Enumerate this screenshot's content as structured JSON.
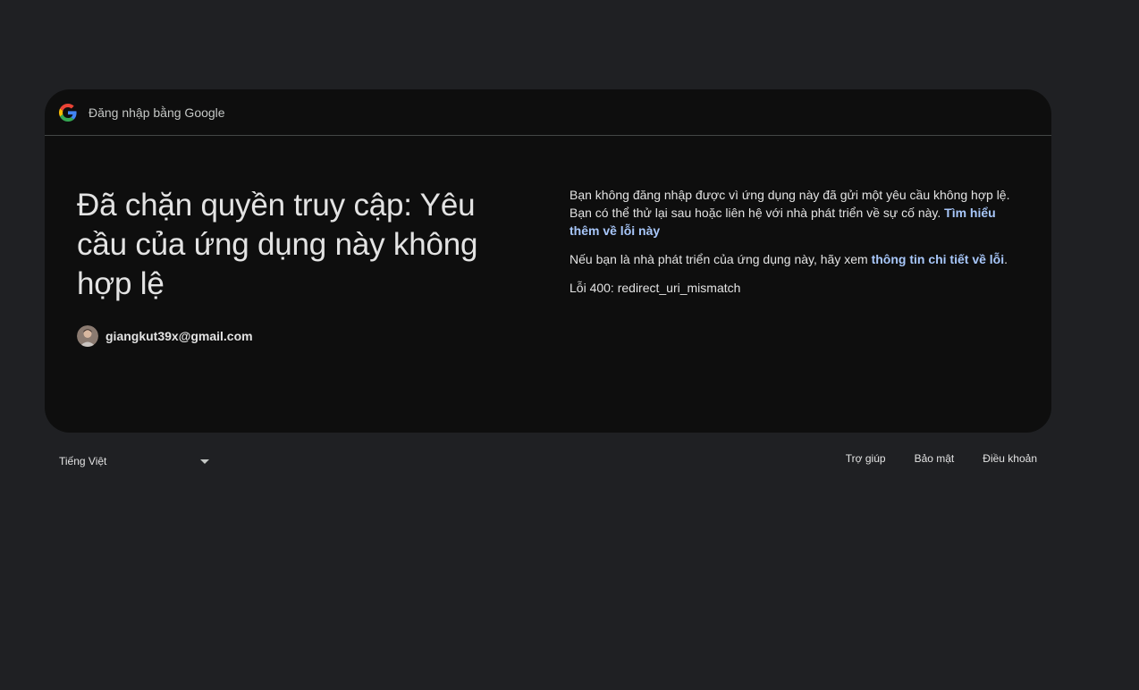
{
  "header": {
    "title": "Đăng nhập bằng Google",
    "logo_icon": "google-g-icon"
  },
  "main": {
    "headline": "Đã chặn quyền truy cập: Yêu cầu của ứng dụng này không hợp lệ",
    "account_email": "giangkut39x@gmail.com",
    "paragraph1_text": "Bạn không đăng nhập được vì ứng dụng này đã gửi một yêu cầu không hợp lệ. Bạn có thể thử lại sau hoặc liên hệ với nhà phát triển về sự cố này. ",
    "paragraph1_link": "Tìm hiểu thêm về lỗi này",
    "paragraph2_text": "Nếu bạn là nhà phát triển của ứng dụng này, hãy xem ",
    "paragraph2_link": "thông tin chi tiết về lỗi",
    "paragraph2_end": ".",
    "error_code": "Lỗi 400: redirect_uri_mismatch"
  },
  "footer": {
    "language": "Tiếng Việt",
    "links": [
      "Trợ giúp",
      "Bảo mật",
      "Điều khoản"
    ]
  },
  "colors": {
    "page_background": "#1f2023",
    "card_background": "#0e0e0e",
    "link": "#a8c7fa",
    "text": "#e3e3e3"
  }
}
